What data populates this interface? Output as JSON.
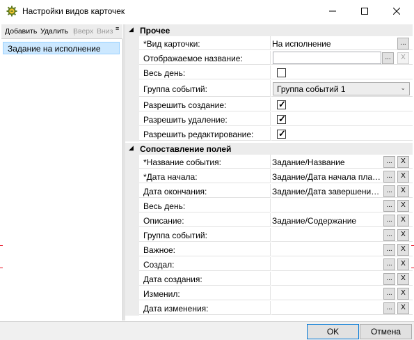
{
  "window": {
    "title": "Настройки видов карточек"
  },
  "toolbar": {
    "add": "Добавить",
    "delete": "Удалить",
    "up": "Вверх",
    "down": "Вниз"
  },
  "list": {
    "items": [
      "Задание на исполнение"
    ]
  },
  "grid": {
    "cat_other": "Прочее",
    "cat_mapping": "Сопоставление полей",
    "card_type_label": "*Вид карточки:",
    "card_type_value": "На исполнение",
    "display_name_label": "Отображаемое название:",
    "display_name_value": "",
    "all_day_label": "Весь день:",
    "all_day_checked": false,
    "event_group_label": "Группа событий:",
    "event_group_value": "Группа событий 1",
    "allow_create_label": "Разрешить создание:",
    "allow_create_checked": true,
    "allow_delete_label": "Разрешить удаление:",
    "allow_delete_checked": true,
    "allow_edit_label": "Разрешить редактирование:",
    "allow_edit_checked": true,
    "mapping": [
      {
        "label": "*Название события:",
        "value": "Задание/Название"
      },
      {
        "label": "*Дата начала:",
        "value": "Задание/Дата начала план..."
      },
      {
        "label": "Дата окончания:",
        "value": "Задание/Дата завершения..."
      },
      {
        "label": "Весь день:",
        "value": ""
      },
      {
        "label": "Описание:",
        "value": "Задание/Содержание"
      },
      {
        "label": "Группа событий:",
        "value": ""
      },
      {
        "label": "Важное:",
        "value": ""
      },
      {
        "label": "Создал:",
        "value": ""
      },
      {
        "label": "Дата создания:",
        "value": ""
      },
      {
        "label": "Изменил:",
        "value": ""
      },
      {
        "label": "Дата изменения:",
        "value": ""
      }
    ],
    "browse_label": "...",
    "clear_label": "X"
  },
  "footer": {
    "ok": "OK",
    "cancel": "Отмена"
  }
}
